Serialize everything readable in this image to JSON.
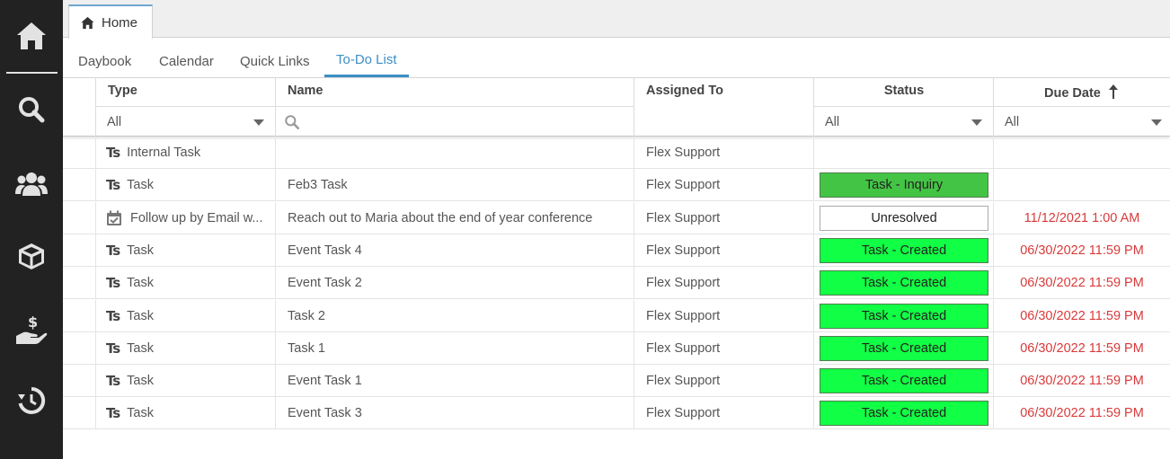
{
  "rail": {
    "items": [
      {
        "name": "home-icon"
      },
      {
        "name": "search-icon"
      },
      {
        "name": "people-icon"
      },
      {
        "name": "box-icon"
      },
      {
        "name": "donation-hand-icon"
      },
      {
        "name": "history-icon"
      }
    ]
  },
  "window_tab": {
    "label": "Home"
  },
  "subtabs": [
    {
      "label": "Daybook"
    },
    {
      "label": "Calendar"
    },
    {
      "label": "Quick Links"
    },
    {
      "label": "To-Do List",
      "active": true
    }
  ],
  "grid": {
    "columns": {
      "type": "Type",
      "name": "Name",
      "assigned": "Assigned To",
      "status": "Status",
      "due": "Due Date"
    },
    "filters": {
      "type": "All",
      "status": "All",
      "due": "All"
    },
    "rows": [
      {
        "type_icon": "Ts",
        "type": "Internal Task",
        "name": "",
        "assigned": "Flex Support",
        "status": "",
        "due": ""
      },
      {
        "type_icon": "Ts",
        "type": "Task",
        "name": "Feb3 Task",
        "assigned": "Flex Support",
        "status": "Task - Inquiry",
        "due": ""
      },
      {
        "type_icon": "calendar-check-icon",
        "type": "Follow up by Email w...",
        "name": "Reach out to Maria about the end of year conference",
        "assigned": "Flex Support",
        "status": "Unresolved",
        "due": "11/12/2021 1:00 AM"
      },
      {
        "type_icon": "Ts",
        "type": "Task",
        "name": "Event Task 4",
        "assigned": "Flex Support",
        "status": "Task - Created",
        "due": "06/30/2022 11:59 PM"
      },
      {
        "type_icon": "Ts",
        "type": "Task",
        "name": "Event Task 2",
        "assigned": "Flex Support",
        "status": "Task - Created",
        "due": "06/30/2022 11:59 PM"
      },
      {
        "type_icon": "Ts",
        "type": "Task",
        "name": "Task 2",
        "assigned": "Flex Support",
        "status": "Task - Created",
        "due": "06/30/2022 11:59 PM"
      },
      {
        "type_icon": "Ts",
        "type": "Task",
        "name": "Task 1",
        "assigned": "Flex Support",
        "status": "Task - Created",
        "due": "06/30/2022 11:59 PM"
      },
      {
        "type_icon": "Ts",
        "type": "Task",
        "name": "Event Task 1",
        "assigned": "Flex Support",
        "status": "Task - Created",
        "due": "06/30/2022 11:59 PM"
      },
      {
        "type_icon": "Ts",
        "type": "Task",
        "name": "Event Task 3",
        "assigned": "Flex Support",
        "status": "Task - Created",
        "due": "06/30/2022 11:59 PM"
      }
    ]
  },
  "colors": {
    "rail_bg": "#222222",
    "accent": "#3d8fc6",
    "status_inquiry": "#44c444",
    "status_created": "#11ff44",
    "status_unresolved": "#ffffff",
    "due_text": "#d93a3a"
  }
}
